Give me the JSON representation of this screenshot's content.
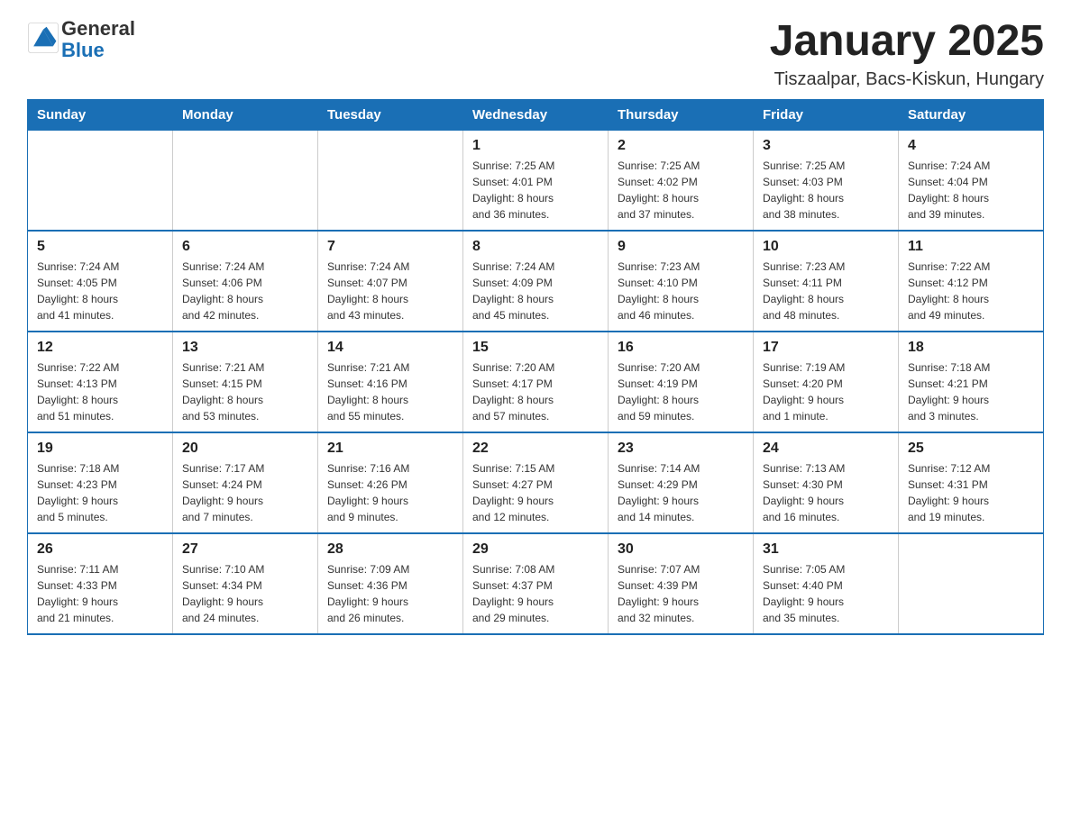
{
  "header": {
    "logo_text_general": "General",
    "logo_text_blue": "Blue",
    "month_title": "January 2025",
    "subtitle": "Tiszaalpar, Bacs-Kiskun, Hungary"
  },
  "days_of_week": [
    "Sunday",
    "Monday",
    "Tuesday",
    "Wednesday",
    "Thursday",
    "Friday",
    "Saturday"
  ],
  "weeks": [
    [
      {
        "day": "",
        "info": ""
      },
      {
        "day": "",
        "info": ""
      },
      {
        "day": "",
        "info": ""
      },
      {
        "day": "1",
        "info": "Sunrise: 7:25 AM\nSunset: 4:01 PM\nDaylight: 8 hours\nand 36 minutes."
      },
      {
        "day": "2",
        "info": "Sunrise: 7:25 AM\nSunset: 4:02 PM\nDaylight: 8 hours\nand 37 minutes."
      },
      {
        "day": "3",
        "info": "Sunrise: 7:25 AM\nSunset: 4:03 PM\nDaylight: 8 hours\nand 38 minutes."
      },
      {
        "day": "4",
        "info": "Sunrise: 7:24 AM\nSunset: 4:04 PM\nDaylight: 8 hours\nand 39 minutes."
      }
    ],
    [
      {
        "day": "5",
        "info": "Sunrise: 7:24 AM\nSunset: 4:05 PM\nDaylight: 8 hours\nand 41 minutes."
      },
      {
        "day": "6",
        "info": "Sunrise: 7:24 AM\nSunset: 4:06 PM\nDaylight: 8 hours\nand 42 minutes."
      },
      {
        "day": "7",
        "info": "Sunrise: 7:24 AM\nSunset: 4:07 PM\nDaylight: 8 hours\nand 43 minutes."
      },
      {
        "day": "8",
        "info": "Sunrise: 7:24 AM\nSunset: 4:09 PM\nDaylight: 8 hours\nand 45 minutes."
      },
      {
        "day": "9",
        "info": "Sunrise: 7:23 AM\nSunset: 4:10 PM\nDaylight: 8 hours\nand 46 minutes."
      },
      {
        "day": "10",
        "info": "Sunrise: 7:23 AM\nSunset: 4:11 PM\nDaylight: 8 hours\nand 48 minutes."
      },
      {
        "day": "11",
        "info": "Sunrise: 7:22 AM\nSunset: 4:12 PM\nDaylight: 8 hours\nand 49 minutes."
      }
    ],
    [
      {
        "day": "12",
        "info": "Sunrise: 7:22 AM\nSunset: 4:13 PM\nDaylight: 8 hours\nand 51 minutes."
      },
      {
        "day": "13",
        "info": "Sunrise: 7:21 AM\nSunset: 4:15 PM\nDaylight: 8 hours\nand 53 minutes."
      },
      {
        "day": "14",
        "info": "Sunrise: 7:21 AM\nSunset: 4:16 PM\nDaylight: 8 hours\nand 55 minutes."
      },
      {
        "day": "15",
        "info": "Sunrise: 7:20 AM\nSunset: 4:17 PM\nDaylight: 8 hours\nand 57 minutes."
      },
      {
        "day": "16",
        "info": "Sunrise: 7:20 AM\nSunset: 4:19 PM\nDaylight: 8 hours\nand 59 minutes."
      },
      {
        "day": "17",
        "info": "Sunrise: 7:19 AM\nSunset: 4:20 PM\nDaylight: 9 hours\nand 1 minute."
      },
      {
        "day": "18",
        "info": "Sunrise: 7:18 AM\nSunset: 4:21 PM\nDaylight: 9 hours\nand 3 minutes."
      }
    ],
    [
      {
        "day": "19",
        "info": "Sunrise: 7:18 AM\nSunset: 4:23 PM\nDaylight: 9 hours\nand 5 minutes."
      },
      {
        "day": "20",
        "info": "Sunrise: 7:17 AM\nSunset: 4:24 PM\nDaylight: 9 hours\nand 7 minutes."
      },
      {
        "day": "21",
        "info": "Sunrise: 7:16 AM\nSunset: 4:26 PM\nDaylight: 9 hours\nand 9 minutes."
      },
      {
        "day": "22",
        "info": "Sunrise: 7:15 AM\nSunset: 4:27 PM\nDaylight: 9 hours\nand 12 minutes."
      },
      {
        "day": "23",
        "info": "Sunrise: 7:14 AM\nSunset: 4:29 PM\nDaylight: 9 hours\nand 14 minutes."
      },
      {
        "day": "24",
        "info": "Sunrise: 7:13 AM\nSunset: 4:30 PM\nDaylight: 9 hours\nand 16 minutes."
      },
      {
        "day": "25",
        "info": "Sunrise: 7:12 AM\nSunset: 4:31 PM\nDaylight: 9 hours\nand 19 minutes."
      }
    ],
    [
      {
        "day": "26",
        "info": "Sunrise: 7:11 AM\nSunset: 4:33 PM\nDaylight: 9 hours\nand 21 minutes."
      },
      {
        "day": "27",
        "info": "Sunrise: 7:10 AM\nSunset: 4:34 PM\nDaylight: 9 hours\nand 24 minutes."
      },
      {
        "day": "28",
        "info": "Sunrise: 7:09 AM\nSunset: 4:36 PM\nDaylight: 9 hours\nand 26 minutes."
      },
      {
        "day": "29",
        "info": "Sunrise: 7:08 AM\nSunset: 4:37 PM\nDaylight: 9 hours\nand 29 minutes."
      },
      {
        "day": "30",
        "info": "Sunrise: 7:07 AM\nSunset: 4:39 PM\nDaylight: 9 hours\nand 32 minutes."
      },
      {
        "day": "31",
        "info": "Sunrise: 7:05 AM\nSunset: 4:40 PM\nDaylight: 9 hours\nand 35 minutes."
      },
      {
        "day": "",
        "info": ""
      }
    ]
  ]
}
